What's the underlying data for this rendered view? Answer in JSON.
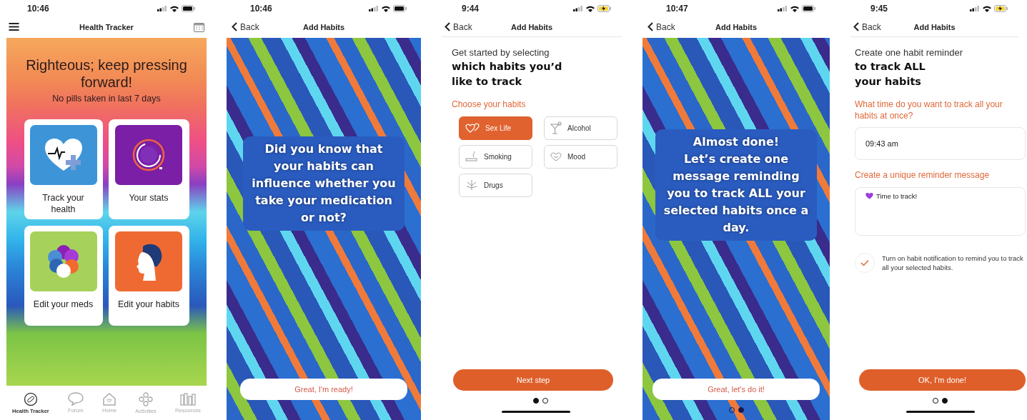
{
  "screens": [
    {
      "kind": "home",
      "time": "10:46",
      "charging": false,
      "title": "Health Tracker",
      "banner_title": "Righteous; keep pressing forward!",
      "banner_subtitle": "No pills taken in last 7 days",
      "tiles": [
        {
          "label": "Track your health",
          "color": "#3d95d8"
        },
        {
          "label": "Your stats",
          "color": "#7b1fa6"
        },
        {
          "label": "Edit your meds",
          "color": "#a6d25c"
        },
        {
          "label": "Edit your habits",
          "color": "#ef6a32"
        }
      ],
      "tabs": [
        {
          "label": "Health Tracker",
          "selected": true
        },
        {
          "label": "Forum",
          "selected": false
        },
        {
          "label": "Home",
          "selected": false
        },
        {
          "label": "Activities",
          "selected": false
        },
        {
          "label": "Resources",
          "selected": false
        }
      ]
    },
    {
      "kind": "splash",
      "time": "10:46",
      "charging": false,
      "back": "Back",
      "title": "Add Habits",
      "message": "Did you know that your habits can influence whether you take your medication or not?",
      "button": "Great, I'm ready!"
    },
    {
      "kind": "habits",
      "time": "9:44",
      "charging": true,
      "back": "Back",
      "title": "Add Habits",
      "intro": "Get started by selecting",
      "headline": "which habits you’d like to track",
      "section_label": "Choose your habits",
      "options": [
        {
          "label": "Sex Life",
          "selected": true
        },
        {
          "label": "Alcohol",
          "selected": false
        },
        {
          "label": "Smoking",
          "selected": false
        },
        {
          "label": "Mood",
          "selected": false
        },
        {
          "label": "Drugs",
          "selected": false
        }
      ],
      "button": "Next step",
      "dots": [
        {
          "selected": true
        },
        {
          "selected": false
        }
      ]
    },
    {
      "kind": "splash",
      "time": "10:47",
      "charging": false,
      "back": "Back",
      "title": "Add Habits",
      "message": "Almost done!\nLet’s create one message reminding you to track ALL your selected habits once a day.",
      "button": "Great, let's do it!",
      "dots": [
        {
          "selected": false
        },
        {
          "selected": true
        }
      ]
    },
    {
      "kind": "reminder",
      "time": "9:45",
      "charging": true,
      "back": "Back",
      "title": "Add Habits",
      "intro": "Create one habit reminder",
      "headline": "to track ALL your habits",
      "time_question": "What time do you want to track all your habits at once?",
      "time_value": "09:43 am",
      "message_label": "Create a unique reminder message",
      "message_value": "Time to track!",
      "notification": {
        "checked": true,
        "label": "Turn on habit notification to remind you to track all your selected habits."
      },
      "button": "OK, I'm done!",
      "dots": [
        {
          "selected": false
        },
        {
          "selected": true
        }
      ]
    }
  ]
}
